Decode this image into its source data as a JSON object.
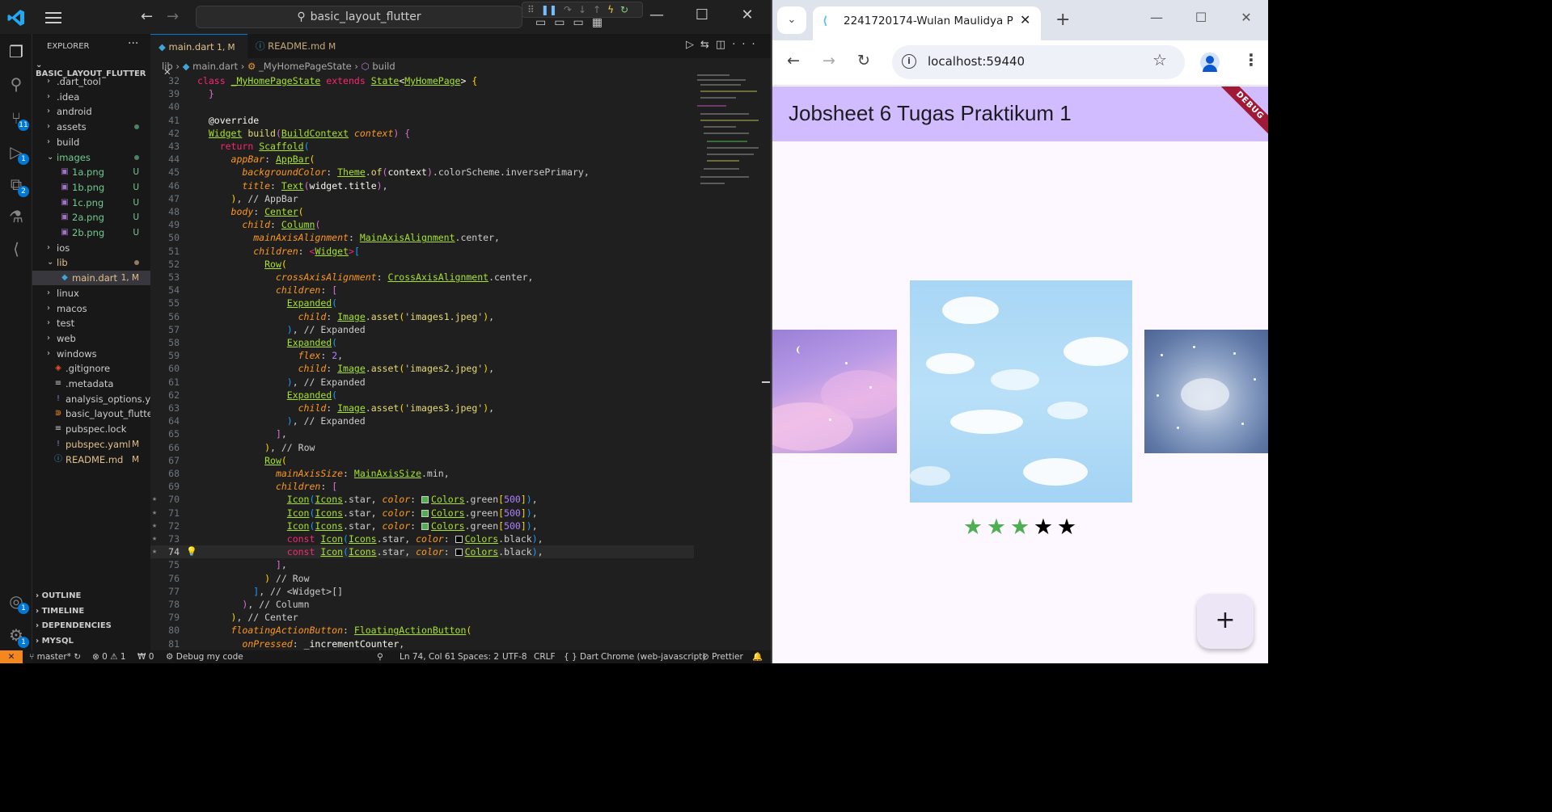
{
  "vscode": {
    "search_text": "basic_layout_flutter",
    "explorer_title": "EXPLORER",
    "project_name": "BASIC_LAYOUT_FLUTTER",
    "badges": {
      "source_control": "11",
      "run_debug": "1",
      "extensions": "2",
      "accounts": "1",
      "manage": "1"
    },
    "tree": [
      {
        "name": ".dart_tool",
        "type": "folder",
        "indent": 0,
        "expanded": false
      },
      {
        "name": ".idea",
        "type": "folder",
        "indent": 0,
        "expanded": false
      },
      {
        "name": "android",
        "type": "folder",
        "indent": 0,
        "expanded": false
      },
      {
        "name": "assets",
        "type": "folder",
        "indent": 0,
        "expanded": false,
        "dot": true
      },
      {
        "name": "build",
        "type": "folder",
        "indent": 0,
        "expanded": false
      },
      {
        "name": "images",
        "type": "folder",
        "indent": 0,
        "expanded": true,
        "dot": true,
        "color": "#73c991"
      },
      {
        "name": "1a.png",
        "type": "image",
        "indent": 1,
        "status": "U",
        "color": "#73c991"
      },
      {
        "name": "1b.png",
        "type": "image",
        "indent": 1,
        "status": "U",
        "color": "#73c991"
      },
      {
        "name": "1c.png",
        "type": "image",
        "indent": 1,
        "status": "U",
        "color": "#73c991"
      },
      {
        "name": "2a.png",
        "type": "image",
        "indent": 1,
        "status": "U",
        "color": "#73c991"
      },
      {
        "name": "2b.png",
        "type": "image",
        "indent": 1,
        "status": "U",
        "color": "#73c991"
      },
      {
        "name": "ios",
        "type": "folder",
        "indent": 0,
        "expanded": false
      },
      {
        "name": "lib",
        "type": "folder",
        "indent": 0,
        "expanded": true,
        "dot": true,
        "color": "#e2c08d"
      },
      {
        "name": "main.dart",
        "type": "dart",
        "indent": 1,
        "status": "1, M",
        "color": "#e2c08d",
        "selected": true
      },
      {
        "name": "linux",
        "type": "folder",
        "indent": 0,
        "expanded": false
      },
      {
        "name": "macos",
        "type": "folder",
        "indent": 0,
        "expanded": false
      },
      {
        "name": "test",
        "type": "folder",
        "indent": 0,
        "expanded": false
      },
      {
        "name": "web",
        "type": "folder",
        "indent": 0,
        "expanded": false
      },
      {
        "name": "windows",
        "type": "folder",
        "indent": 0,
        "expanded": false
      },
      {
        "name": ".gitignore",
        "type": "git",
        "indent": 0
      },
      {
        "name": ".metadata",
        "type": "meta",
        "indent": 0
      },
      {
        "name": "analysis_options.yaml",
        "type": "yaml",
        "indent": 0
      },
      {
        "name": "basic_layout_flutter.iml",
        "type": "iml",
        "indent": 0
      },
      {
        "name": "pubspec.lock",
        "type": "lock",
        "indent": 0
      },
      {
        "name": "pubspec.yaml",
        "type": "yaml",
        "indent": 0,
        "status": "M",
        "color": "#e2c08d"
      },
      {
        "name": "README.md",
        "type": "info",
        "indent": 0,
        "status": "M",
        "color": "#e2c08d"
      }
    ],
    "panels": [
      "OUTLINE",
      "TIMELINE",
      "DEPENDENCIES",
      "MYSQL"
    ],
    "tabs": [
      {
        "label": "main.dart",
        "suffix": "1, M",
        "active": true
      },
      {
        "label": "README.md",
        "suffix": "M",
        "active": false
      }
    ],
    "breadcrumb": [
      "lib",
      "main.dart",
      "_MyHomePageState",
      "build"
    ],
    "code_lines": [
      {
        "n": "32",
        "html": "<span class='k'>class</span> <span class='t'>_MyHomePageState</span> <span class='k'>extends</span> <span class='t'>State</span><span class='w'>&lt;</span><span class='t'>MyHomePage</span><span class='w'>&gt;</span> <span class='br1'>{</span>"
      },
      {
        "n": "39",
        "html": "  <span class='br2'>}</span>"
      },
      {
        "n": "40",
        "html": ""
      },
      {
        "n": "41",
        "html": "  <span class='w'>@override</span>"
      },
      {
        "n": "42",
        "html": "  <span class='t'>Widget</span> <span class='f'>build</span><span class='br2'>(</span><span class='t'>BuildContext</span> <span class='p'>context</span><span class='br2'>)</span> <span class='br2'>{</span>"
      },
      {
        "n": "43",
        "html": "    <span class='k'>return</span> <span class='t'>Scaffold</span><span class='br3'>(</span>"
      },
      {
        "n": "44",
        "html": "      <span class='p'>appBar</span><span class='c'>:</span> <span class='t'>AppBar</span><span class='br1'>(</span>"
      },
      {
        "n": "45",
        "html": "        <span class='p'>backgroundColor</span><span class='c'>:</span> <span class='t'>Theme</span><span class='c'>.</span><span class='f'>of</span><span class='br2'>(</span><span class='w'>context</span><span class='br2'>)</span><span class='c'>.colorScheme.inversePrimary,</span>"
      },
      {
        "n": "46",
        "html": "        <span class='p'>title</span><span class='c'>:</span> <span class='t'>Text</span><span class='br2'>(</span><span class='w'>widget.title</span><span class='br2'>)</span><span class='c'>,</span>"
      },
      {
        "n": "47",
        "html": "      <span class='br1'>)</span><span class='c'>, // AppBar</span>"
      },
      {
        "n": "48",
        "html": "      <span class='p'>body</span><span class='c'>:</span> <span class='t'>Center</span><span class='br1'>(</span>"
      },
      {
        "n": "49",
        "html": "        <span class='p'>child</span><span class='c'>:</span> <span class='t'>Column</span><span class='br2'>(</span>"
      },
      {
        "n": "50",
        "html": "          <span class='p'>mainAxisAlignment</span><span class='c'>:</span> <span class='t'>MainAxisAlignment</span><span class='c'>.center,</span>"
      },
      {
        "n": "51",
        "html": "          <span class='p'>children</span><span class='c'>:</span> <span class='k'>&lt;</span><span class='t'>Widget</span><span class='k'>&gt;</span><span class='br3'>[</span>"
      },
      {
        "n": "52",
        "html": "            <span class='t'>Row</span><span class='br1'>(</span>"
      },
      {
        "n": "53",
        "html": "              <span class='p'>crossAxisAlignment</span><span class='c'>:</span> <span class='t'>CrossAxisAlignment</span><span class='c'>.center,</span>"
      },
      {
        "n": "54",
        "html": "              <span class='p'>children</span><span class='c'>:</span> <span class='br2'>[</span>"
      },
      {
        "n": "55",
        "html": "                <span class='t'>Expanded</span><span class='br3'>(</span>"
      },
      {
        "n": "56",
        "html": "                  <span class='p'>child</span><span class='c'>:</span> <span class='t'>Image</span><span class='c'>.</span><span class='f'>asset</span><span class='br1'>(</span><span class='s'>'images1.jpeg'</span><span class='br1'>)</span><span class='c'>,</span>"
      },
      {
        "n": "57",
        "html": "                <span class='br3'>)</span><span class='c'>, // Expanded</span>"
      },
      {
        "n": "58",
        "html": "                <span class='t'>Expanded</span><span class='br3'>(</span>"
      },
      {
        "n": "59",
        "html": "                  <span class='p'>flex</span><span class='c'>:</span> <span class='n'>2</span><span class='c'>,</span>"
      },
      {
        "n": "60",
        "html": "                  <span class='p'>child</span><span class='c'>:</span> <span class='t'>Image</span><span class='c'>.</span><span class='f'>asset</span><span class='br1'>(</span><span class='s'>'images2.jpeg'</span><span class='br1'>)</span><span class='c'>,</span>"
      },
      {
        "n": "61",
        "html": "                <span class='br3'>)</span><span class='c'>, // Expanded</span>"
      },
      {
        "n": "62",
        "html": "                <span class='t'>Expanded</span><span class='br3'>(</span>"
      },
      {
        "n": "63",
        "html": "                  <span class='p'>child</span><span class='c'>:</span> <span class='t'>Image</span><span class='c'>.</span><span class='f'>asset</span><span class='br1'>(</span><span class='s'>'images3.jpeg'</span><span class='br1'>)</span><span class='c'>,</span>"
      },
      {
        "n": "64",
        "html": "                <span class='br3'>)</span><span class='c'>, // Expanded</span>"
      },
      {
        "n": "65",
        "html": "              <span class='br2'>]</span><span class='c'>,</span>"
      },
      {
        "n": "66",
        "html": "            <span class='br1'>)</span><span class='c'>, // Row</span>"
      },
      {
        "n": "67",
        "html": "            <span class='t'>Row</span><span class='br1'>(</span>"
      },
      {
        "n": "68",
        "html": "              <span class='p'>mainAxisSize</span><span class='c'>:</span> <span class='t'>MainAxisSize</span><span class='c'>.min,</span>"
      },
      {
        "n": "69",
        "html": "              <span class='p'>children</span><span class='c'>:</span> <span class='br2'>[</span>"
      },
      {
        "n": "70",
        "star": true,
        "html": "                <span class='t'>Icon</span><span class='br3'>(</span><span class='t'>Icons</span><span class='c'>.star,</span> <span class='p'>color</span><span class='c'>:</span> <span class='sw' style='background:#4caf50'></span><span class='t'>Colors</span><span class='c'>.green</span><span class='br1'>[</span><span class='n'>500</span><span class='br1'>]</span><span class='br3'>)</span><span class='c'>,</span>"
      },
      {
        "n": "71",
        "star": true,
        "html": "                <span class='t'>Icon</span><span class='br3'>(</span><span class='t'>Icons</span><span class='c'>.star,</span> <span class='p'>color</span><span class='c'>:</span> <span class='sw' style='background:#4caf50'></span><span class='t'>Colors</span><span class='c'>.green</span><span class='br1'>[</span><span class='n'>500</span><span class='br1'>]</span><span class='br3'>)</span><span class='c'>,</span>"
      },
      {
        "n": "72",
        "star": true,
        "html": "                <span class='t'>Icon</span><span class='br3'>(</span><span class='t'>Icons</span><span class='c'>.star,</span> <span class='p'>color</span><span class='c'>:</span> <span class='sw' style='background:#4caf50'></span><span class='t'>Colors</span><span class='c'>.green</span><span class='br1'>[</span><span class='n'>500</span><span class='br1'>]</span><span class='br3'>)</span><span class='c'>,</span>"
      },
      {
        "n": "73",
        "star": true,
        "html": "                <span class='k'>const</span> <span class='t'>Icon</span><span class='br3'>(</span><span class='t'>Icons</span><span class='c'>.star,</span> <span class='p'>color</span><span class='c'>:</span> <span class='sw' style='background:#000'></span><span class='t'>Colors</span><span class='c'>.black</span><span class='br3'>)</span><span class='c'>,</span>"
      },
      {
        "n": "74",
        "star": true,
        "cur": true,
        "html": "                <span class='k'>const</span> <span class='t'>Icon</span><span class='br3'>(</span><span class='t'>Icons</span><span class='c'>.star,</span> <span class='p'>color</span><span class='c'>:</span> <span class='sw' style='background:#000'></span><span class='t'>Colors</span><span class='c'>.black</span><span class='br3'>)</span><span class='c'>,</span>"
      },
      {
        "n": "75",
        "html": "              <span class='br2'>]</span><span class='c'>,</span>"
      },
      {
        "n": "76",
        "html": "            <span class='br1'>)</span> <span class='c'>// Row</span>"
      },
      {
        "n": "77",
        "html": "          <span class='br3'>]</span><span class='c'>, // &lt;Widget&gt;[]</span>"
      },
      {
        "n": "78",
        "html": "        <span class='br2'>)</span><span class='c'>, // Column</span>"
      },
      {
        "n": "79",
        "html": "      <span class='br1'>)</span><span class='c'>, // Center</span>"
      },
      {
        "n": "80",
        "html": "      <span class='p'>floatingActionButton</span><span class='c'>:</span> <span class='t'>FloatingActionButton</span><span class='br1'>(</span>"
      },
      {
        "n": "81",
        "html": "        <span class='p'>onPressed</span><span class='c'>:</span> <span class='w'>_incrementCounter</span><span class='c'>,</span>"
      }
    ],
    "status": {
      "branch": "master*",
      "problems": "⊗ 0 ⚠ 1",
      "ports": "₩ 0",
      "debug_label": "Debug my code",
      "cursor": "Ln 74, Col 61",
      "spaces": "Spaces: 2",
      "encoding": "UTF-8",
      "eol": "CRLF",
      "language": "{ } Dart",
      "device": "Chrome (web-javascript)",
      "formatter": "⊘ Prettier"
    }
  },
  "chrome": {
    "tab_title": "2241720174-Wulan Maulidya P",
    "url": "localhost:59440",
    "app_title": "Jobsheet 6 Tugas Praktikum 1",
    "debug_banner": "DEBUG",
    "stars": [
      {
        "color": "#4caf50"
      },
      {
        "color": "#4caf50"
      },
      {
        "color": "#4caf50"
      },
      {
        "color": "#000000"
      },
      {
        "color": "#000000"
      }
    ],
    "fab_label": "+"
  }
}
